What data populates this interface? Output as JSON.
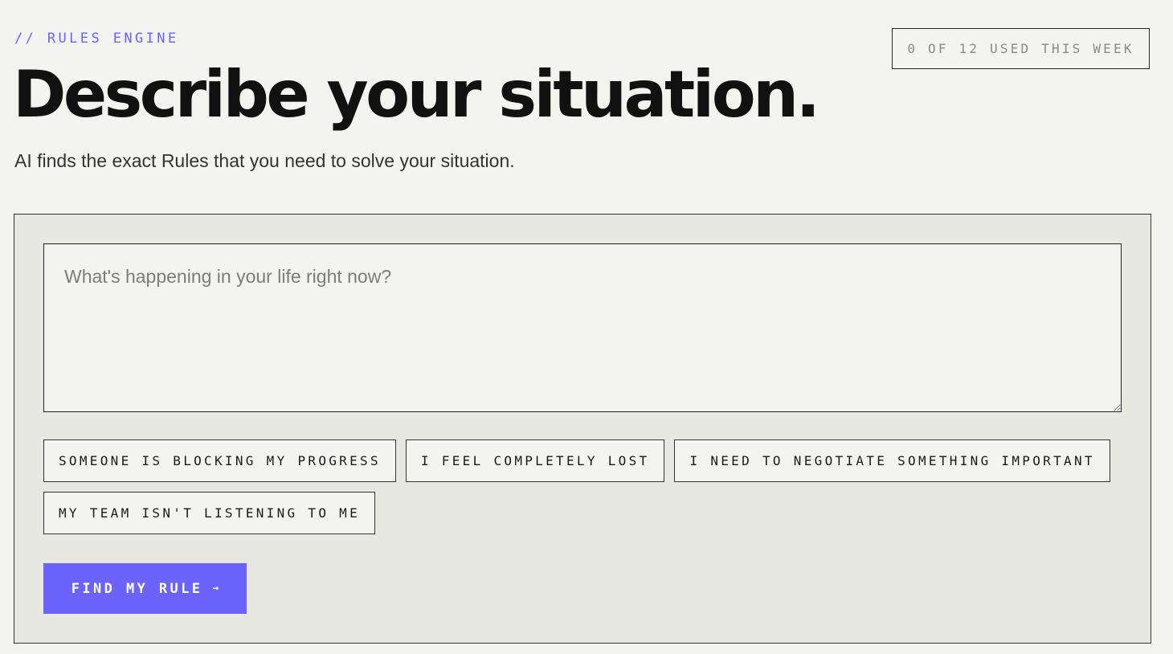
{
  "header": {
    "eyebrow": "// RULES ENGINE",
    "title": "Describe your situation.",
    "subtitle": "AI finds the exact Rules that you need to solve your situation.",
    "usage": "0 OF 12 USED THIS WEEK"
  },
  "form": {
    "input_value": "",
    "input_placeholder": "What's happening in your life right now?",
    "suggestions": [
      "SOMEONE IS BLOCKING MY PROGRESS",
      "I FEEL COMPLETELY LOST",
      "I NEED TO NEGOTIATE SOMETHING IMPORTANT",
      "MY TEAM ISN'T LISTENING TO ME"
    ],
    "submit_label": "FIND MY RULE",
    "submit_icon": "arrow-right-icon",
    "submit_arrow": "→"
  },
  "colors": {
    "accent": "#6c63ff",
    "background": "#f3f3ef",
    "panel": "#e8e8e3",
    "text": "#111111"
  }
}
